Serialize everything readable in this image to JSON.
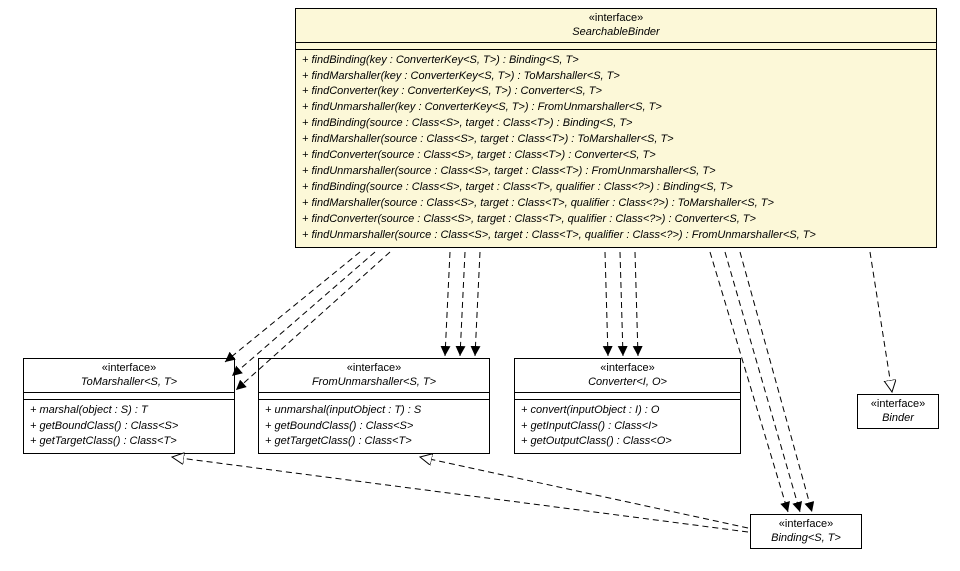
{
  "searchableBinder": {
    "stereo": "«interface»",
    "name": "SearchableBinder",
    "methods": [
      "+ findBinding(key : ConverterKey<S, T>) : Binding<S, T>",
      "+ findMarshaller(key : ConverterKey<S, T>) : ToMarshaller<S, T>",
      "+ findConverter(key : ConverterKey<S, T>) : Converter<S, T>",
      "+ findUnmarshaller(key : ConverterKey<S, T>) : FromUnmarshaller<S, T>",
      "+ findBinding(source : Class<S>, target : Class<T>) : Binding<S, T>",
      "+ findMarshaller(source : Class<S>, target : Class<T>) : ToMarshaller<S, T>",
      "+ findConverter(source : Class<S>, target : Class<T>) : Converter<S, T>",
      "+ findUnmarshaller(source : Class<S>, target : Class<T>) : FromUnmarshaller<S, T>",
      "+ findBinding(source : Class<S>, target : Class<T>, qualifier : Class<?>) : Binding<S, T>",
      "+ findMarshaller(source : Class<S>, target : Class<T>, qualifier : Class<?>) : ToMarshaller<S, T>",
      "+ findConverter(source : Class<S>, target : Class<T>, qualifier : Class<?>) : Converter<S, T>",
      "+ findUnmarshaller(source : Class<S>, target : Class<T>, qualifier : Class<?>) : FromUnmarshaller<S, T>"
    ]
  },
  "toMarshaller": {
    "stereo": "«interface»",
    "name": "ToMarshaller<S, T>",
    "methods": [
      "+ marshal(object : S) : T",
      "+ getBoundClass() : Class<S>",
      "+ getTargetClass() : Class<T>"
    ]
  },
  "fromUnmarshaller": {
    "stereo": "«interface»",
    "name": "FromUnmarshaller<S, T>",
    "methods": [
      "+ unmarshal(inputObject : T) : S",
      "+ getBoundClass() : Class<S>",
      "+ getTargetClass() : Class<T>"
    ]
  },
  "converter": {
    "stereo": "«interface»",
    "name": "Converter<I, O>",
    "methods": [
      "+ convert(inputObject : I) : O",
      "+ getInputClass() : Class<I>",
      "+ getOutputClass() : Class<O>"
    ]
  },
  "binder": {
    "stereo": "«interface»",
    "name": "Binder"
  },
  "binding": {
    "stereo": "«interface»",
    "name": "Binding<S, T>"
  }
}
